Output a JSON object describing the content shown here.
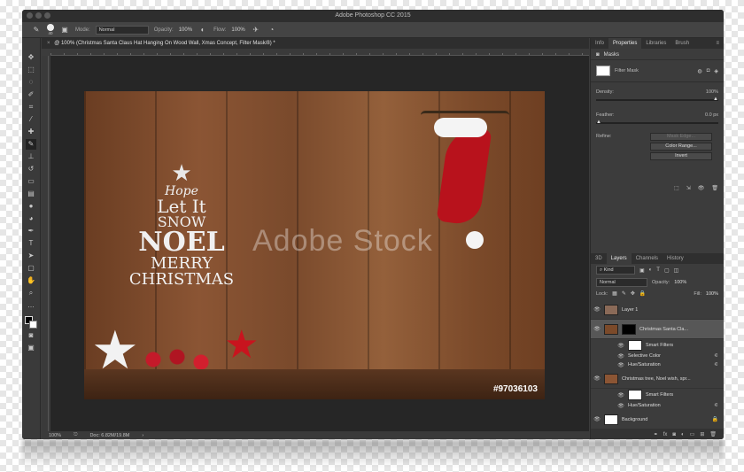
{
  "app": {
    "title": "Adobe Photoshop CC 2015"
  },
  "options_bar": {
    "mode_label": "Mode:",
    "mode_value": "Normal",
    "opacity_label": "Opacity:",
    "opacity_value": "100%",
    "flow_label": "Flow:",
    "flow_value": "100%",
    "brush_size": "40"
  },
  "document": {
    "tab_title": "@ 100% (Christmas Santa Claus Hat Hanging On Wood Wall, Xmas Concept, Filter Mask/8) *",
    "watermark": "Adobe Stock",
    "stock_id": "#97036103",
    "tree_words": [
      "Hope",
      "Let It",
      "SNOW",
      "NOEL",
      "MERRY",
      "CHRISTMAS"
    ]
  },
  "status": {
    "zoom": "100%",
    "doc_size": "Doc: 6.82M/19.8M"
  },
  "properties_panel": {
    "tabs": [
      "Info",
      "Properties",
      "Libraries",
      "Brush"
    ],
    "active_tab": "Properties",
    "section": "Masks",
    "mask_type": "Filter Mask",
    "density_label": "Density:",
    "density_value": "100%",
    "feather_label": "Feather:",
    "feather_value": "0.0 px",
    "refine_label": "Refine:",
    "buttons": [
      "Mask Edge...",
      "Color Range...",
      "Invert"
    ]
  },
  "layers_panel": {
    "tabs": [
      "3D",
      "Layers",
      "Channels",
      "History"
    ],
    "active_tab": "Layers",
    "kind_value": "Kind",
    "blend_mode": "Normal",
    "opacity_label": "Opacity:",
    "opacity_value": "100%",
    "lock_label": "Lock:",
    "fill_label": "Fill:",
    "fill_value": "100%",
    "layers": [
      {
        "name": "Layer 1",
        "thumb_color": "#8a6a58",
        "selected": false
      },
      {
        "name": "Christmas Santa Cla...",
        "thumb_color": "#7b4a2a",
        "selected": true
      },
      {
        "name": "Smart Filters",
        "sub": true
      },
      {
        "name": "Selective Color",
        "sub": true,
        "filter": true
      },
      {
        "name": "Hue/Saturation",
        "sub": true,
        "filter": true
      },
      {
        "name": "Christmas tree, Noel wish, spr...",
        "thumb_color": "#8b5534",
        "selected": false
      },
      {
        "name": "Smart Filters",
        "sub": true
      },
      {
        "name": "Hue/Saturation",
        "sub": true,
        "filter": true
      },
      {
        "name": "Background",
        "thumb_color": "#ffffff",
        "selected": false
      }
    ]
  }
}
